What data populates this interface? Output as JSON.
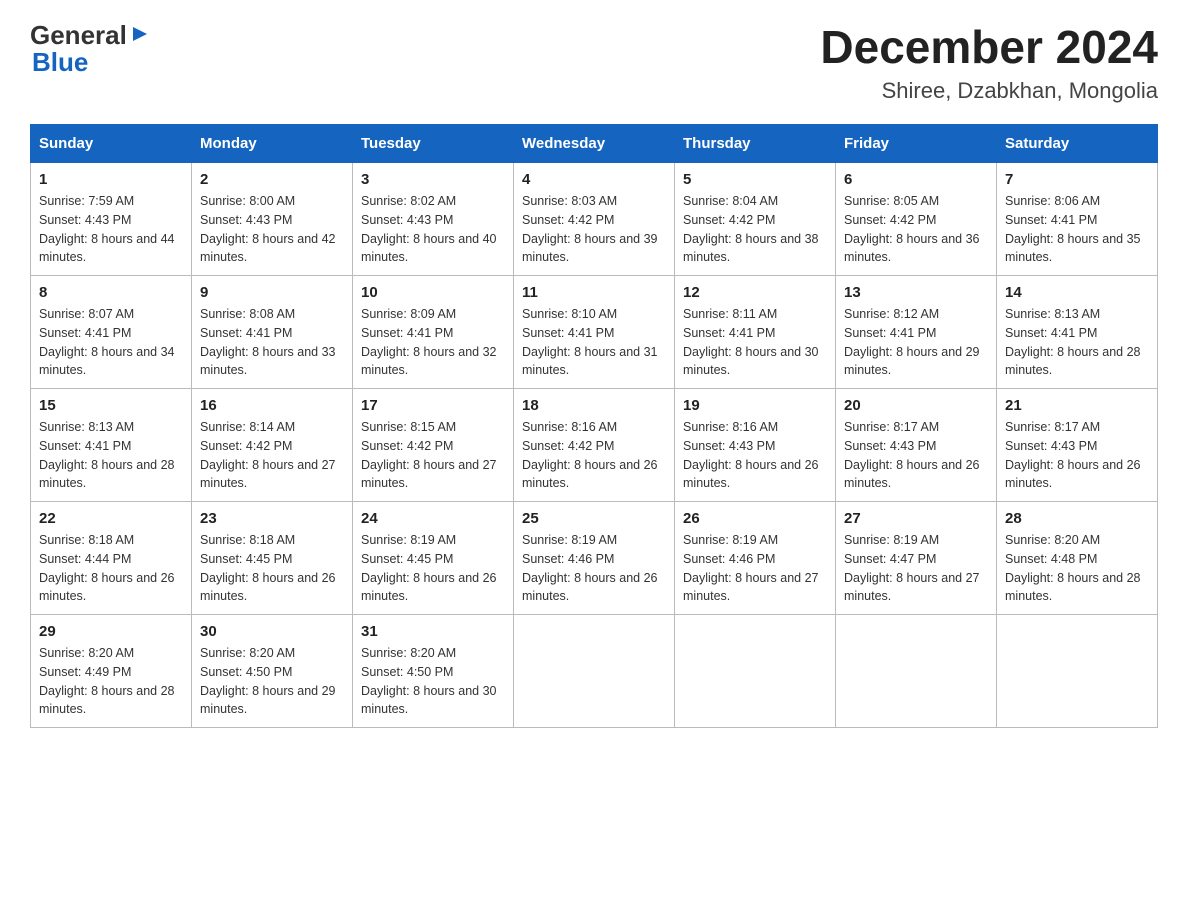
{
  "logo": {
    "text1": "General",
    "text2": "Blue"
  },
  "header": {
    "title": "December 2024",
    "subtitle": "Shiree, Dzabkhan, Mongolia"
  },
  "days": [
    "Sunday",
    "Monday",
    "Tuesday",
    "Wednesday",
    "Thursday",
    "Friday",
    "Saturday"
  ],
  "weeks": [
    [
      {
        "num": "1",
        "sunrise": "7:59 AM",
        "sunset": "4:43 PM",
        "daylight": "8 hours and 44 minutes."
      },
      {
        "num": "2",
        "sunrise": "8:00 AM",
        "sunset": "4:43 PM",
        "daylight": "8 hours and 42 minutes."
      },
      {
        "num": "3",
        "sunrise": "8:02 AM",
        "sunset": "4:43 PM",
        "daylight": "8 hours and 40 minutes."
      },
      {
        "num": "4",
        "sunrise": "8:03 AM",
        "sunset": "4:42 PM",
        "daylight": "8 hours and 39 minutes."
      },
      {
        "num": "5",
        "sunrise": "8:04 AM",
        "sunset": "4:42 PM",
        "daylight": "8 hours and 38 minutes."
      },
      {
        "num": "6",
        "sunrise": "8:05 AM",
        "sunset": "4:42 PM",
        "daylight": "8 hours and 36 minutes."
      },
      {
        "num": "7",
        "sunrise": "8:06 AM",
        "sunset": "4:41 PM",
        "daylight": "8 hours and 35 minutes."
      }
    ],
    [
      {
        "num": "8",
        "sunrise": "8:07 AM",
        "sunset": "4:41 PM",
        "daylight": "8 hours and 34 minutes."
      },
      {
        "num": "9",
        "sunrise": "8:08 AM",
        "sunset": "4:41 PM",
        "daylight": "8 hours and 33 minutes."
      },
      {
        "num": "10",
        "sunrise": "8:09 AM",
        "sunset": "4:41 PM",
        "daylight": "8 hours and 32 minutes."
      },
      {
        "num": "11",
        "sunrise": "8:10 AM",
        "sunset": "4:41 PM",
        "daylight": "8 hours and 31 minutes."
      },
      {
        "num": "12",
        "sunrise": "8:11 AM",
        "sunset": "4:41 PM",
        "daylight": "8 hours and 30 minutes."
      },
      {
        "num": "13",
        "sunrise": "8:12 AM",
        "sunset": "4:41 PM",
        "daylight": "8 hours and 29 minutes."
      },
      {
        "num": "14",
        "sunrise": "8:13 AM",
        "sunset": "4:41 PM",
        "daylight": "8 hours and 28 minutes."
      }
    ],
    [
      {
        "num": "15",
        "sunrise": "8:13 AM",
        "sunset": "4:41 PM",
        "daylight": "8 hours and 28 minutes."
      },
      {
        "num": "16",
        "sunrise": "8:14 AM",
        "sunset": "4:42 PM",
        "daylight": "8 hours and 27 minutes."
      },
      {
        "num": "17",
        "sunrise": "8:15 AM",
        "sunset": "4:42 PM",
        "daylight": "8 hours and 27 minutes."
      },
      {
        "num": "18",
        "sunrise": "8:16 AM",
        "sunset": "4:42 PM",
        "daylight": "8 hours and 26 minutes."
      },
      {
        "num": "19",
        "sunrise": "8:16 AM",
        "sunset": "4:43 PM",
        "daylight": "8 hours and 26 minutes."
      },
      {
        "num": "20",
        "sunrise": "8:17 AM",
        "sunset": "4:43 PM",
        "daylight": "8 hours and 26 minutes."
      },
      {
        "num": "21",
        "sunrise": "8:17 AM",
        "sunset": "4:43 PM",
        "daylight": "8 hours and 26 minutes."
      }
    ],
    [
      {
        "num": "22",
        "sunrise": "8:18 AM",
        "sunset": "4:44 PM",
        "daylight": "8 hours and 26 minutes."
      },
      {
        "num": "23",
        "sunrise": "8:18 AM",
        "sunset": "4:45 PM",
        "daylight": "8 hours and 26 minutes."
      },
      {
        "num": "24",
        "sunrise": "8:19 AM",
        "sunset": "4:45 PM",
        "daylight": "8 hours and 26 minutes."
      },
      {
        "num": "25",
        "sunrise": "8:19 AM",
        "sunset": "4:46 PM",
        "daylight": "8 hours and 26 minutes."
      },
      {
        "num": "26",
        "sunrise": "8:19 AM",
        "sunset": "4:46 PM",
        "daylight": "8 hours and 27 minutes."
      },
      {
        "num": "27",
        "sunrise": "8:19 AM",
        "sunset": "4:47 PM",
        "daylight": "8 hours and 27 minutes."
      },
      {
        "num": "28",
        "sunrise": "8:20 AM",
        "sunset": "4:48 PM",
        "daylight": "8 hours and 28 minutes."
      }
    ],
    [
      {
        "num": "29",
        "sunrise": "8:20 AM",
        "sunset": "4:49 PM",
        "daylight": "8 hours and 28 minutes."
      },
      {
        "num": "30",
        "sunrise": "8:20 AM",
        "sunset": "4:50 PM",
        "daylight": "8 hours and 29 minutes."
      },
      {
        "num": "31",
        "sunrise": "8:20 AM",
        "sunset": "4:50 PM",
        "daylight": "8 hours and 30 minutes."
      },
      null,
      null,
      null,
      null
    ]
  ]
}
